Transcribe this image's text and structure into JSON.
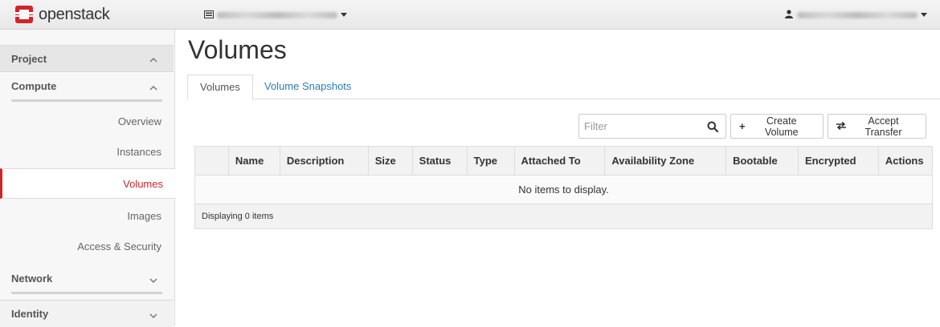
{
  "brand": {
    "name": "openstack",
    "color": "#d2232a"
  },
  "header": {
    "project_icon": "server-icon",
    "user_icon": "user-icon"
  },
  "sidebar": {
    "project_label": "Project",
    "compute_label": "Compute",
    "items": [
      {
        "label": "Overview"
      },
      {
        "label": "Instances"
      },
      {
        "label": "Volumes",
        "active": true
      },
      {
        "label": "Images"
      },
      {
        "label": "Access & Security"
      }
    ],
    "network_label": "Network",
    "identity_label": "Identity"
  },
  "main": {
    "title": "Volumes",
    "tabs": [
      {
        "label": "Volumes"
      },
      {
        "label": "Volume Snapshots"
      }
    ],
    "filter_placeholder": "Filter",
    "create_button": "Create Volume",
    "accept_button": "Accept Transfer",
    "table": {
      "columns": [
        "",
        "Name",
        "Description",
        "Size",
        "Status",
        "Type",
        "Attached To",
        "Availability Zone",
        "Bootable",
        "Encrypted",
        "Actions"
      ],
      "empty_message": "No items to display.",
      "footer": "Displaying 0 items"
    }
  },
  "colors": {
    "accent": "#d2232a",
    "link": "#2a7db8"
  }
}
